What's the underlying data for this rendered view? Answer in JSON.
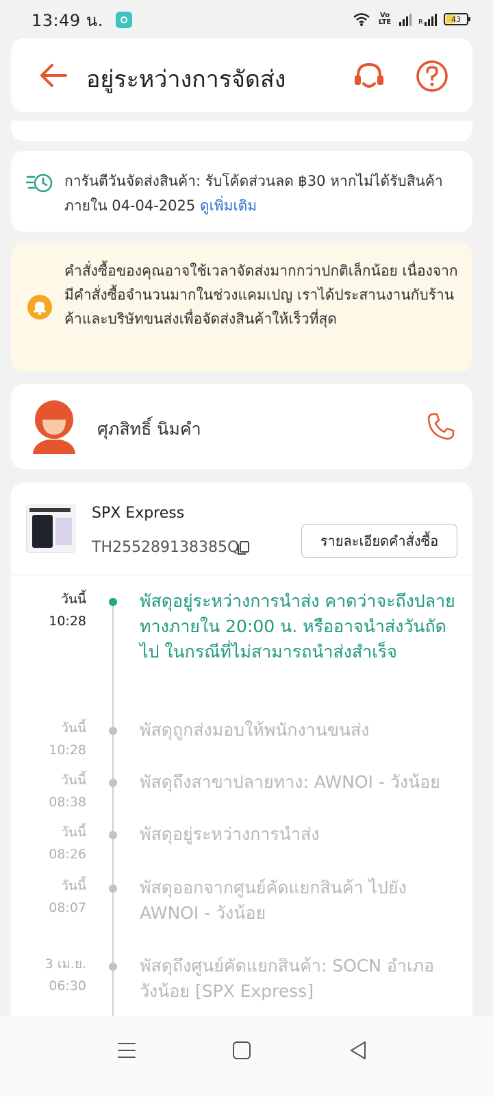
{
  "status_bar": {
    "time": "13:49 น.",
    "volte": "Vo LTE",
    "roaming": "R",
    "battery": "43"
  },
  "header": {
    "title": "อยู่ระหว่างการจัดส่ง",
    "back_icon": "arrow-left-icon",
    "support_icon": "headset-icon",
    "help_icon": "help-circle-icon",
    "accent_color": "#e4572e"
  },
  "guarantee": {
    "text": "การันตีวันจัดส่งสินค้า: รับโค้ดส่วนลด ฿30 หากไม่ได้รับสินค้าภายใน 04-04-2025",
    "link": "ดูเพิ่มเติม"
  },
  "notice": {
    "text": "คำสั่งซื้อของคุณอาจใช้เวลาจัดส่งมากกว่าปกติเล็กน้อย เนื่องจากมีคำสั่งซื้อจำนวนมากในช่วงแคมเปญ เราได้ประสานงานกับร้านค้าและบริษัทขนส่งเพื่อจัดส่งสินค้าให้เร็วที่สุด"
  },
  "driver": {
    "name": "ศุภสิทธิ์ นิมคำ"
  },
  "shipment": {
    "carrier": "SPX Express",
    "tracking_number": "TH255289138385Q",
    "order_detail_button": "รายละเอียดคำสั่งซื้อ"
  },
  "timeline": [
    {
      "day": "วันนี้",
      "time": "10:28",
      "text": "พัสดุอยู่ระหว่างการนำส่ง คาดว่าจะถึงปลายทางภายใน 20:00 น. หรืออาจนำส่งวันถัดไป ในกรณีที่ไม่สามารถนำส่งสำเร็จ",
      "active": true
    },
    {
      "day": "วันนี้",
      "time": "10:28",
      "text": "พัสดุถูกส่งมอบให้พนักงานขนส่ง"
    },
    {
      "day": "วันนี้",
      "time": "08:38",
      "text": "พัสดุถึงสาขาปลายทาง: AWNOI - วังน้อย"
    },
    {
      "day": "วันนี้",
      "time": "08:26",
      "text": "พัสดุอยู่ระหว่างการนำส่ง"
    },
    {
      "day": "วันนี้",
      "time": "08:07",
      "text": "พัสดุออกจากศูนย์คัดแยกสินค้า ไปยัง AWNOI - วังน้อย"
    },
    {
      "day": "3 เม.ย.",
      "time": "06:30",
      "text": "พัสดุถึงศูนย์คัดแยกสินค้า: SOCN อำเภอวังน้อย [SPX Express]"
    }
  ],
  "colors": {
    "active_green": "#1f9a80",
    "link_blue": "#2f6fcf",
    "notice_bg": "#fdf8e8",
    "bell_orange": "#f5a623"
  }
}
